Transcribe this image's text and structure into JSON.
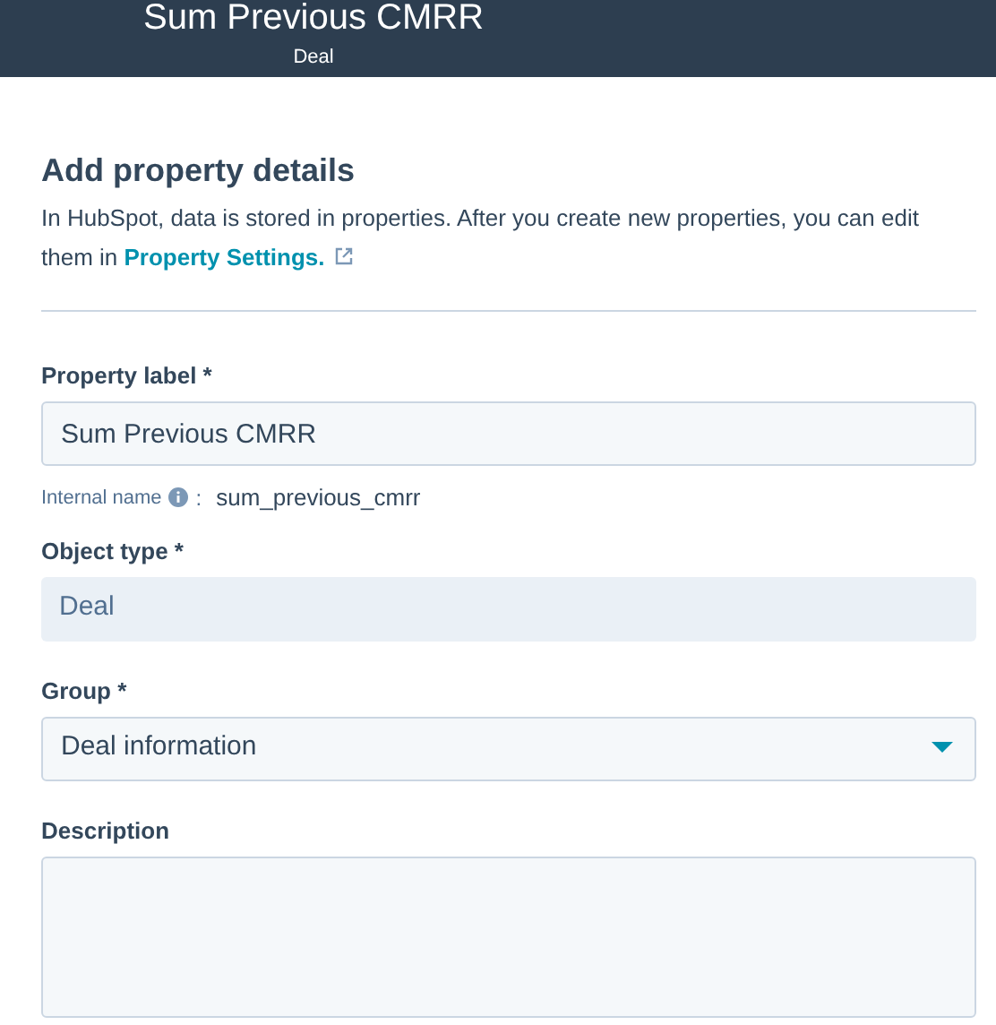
{
  "header": {
    "title": "Sum Previous CMRR",
    "subtitle": "Deal"
  },
  "section": {
    "title": "Add property details",
    "intro": "In HubSpot, data is stored in properties. After you create new properties, you can edit them in",
    "link": "Property Settings."
  },
  "fields": [
    {
      "kind": "text",
      "label": "Property label *",
      "value": "Sum Previous CMRR",
      "hint_label": "Internal name",
      "hint_separator": ":",
      "hint_value": "sum_previous_cmrr"
    },
    {
      "kind": "readonly",
      "label": "Object type *",
      "value": "Deal"
    },
    {
      "kind": "select",
      "label": "Group *",
      "value": "Deal information"
    },
    {
      "kind": "textarea",
      "label": "Description"
    }
  ]
}
